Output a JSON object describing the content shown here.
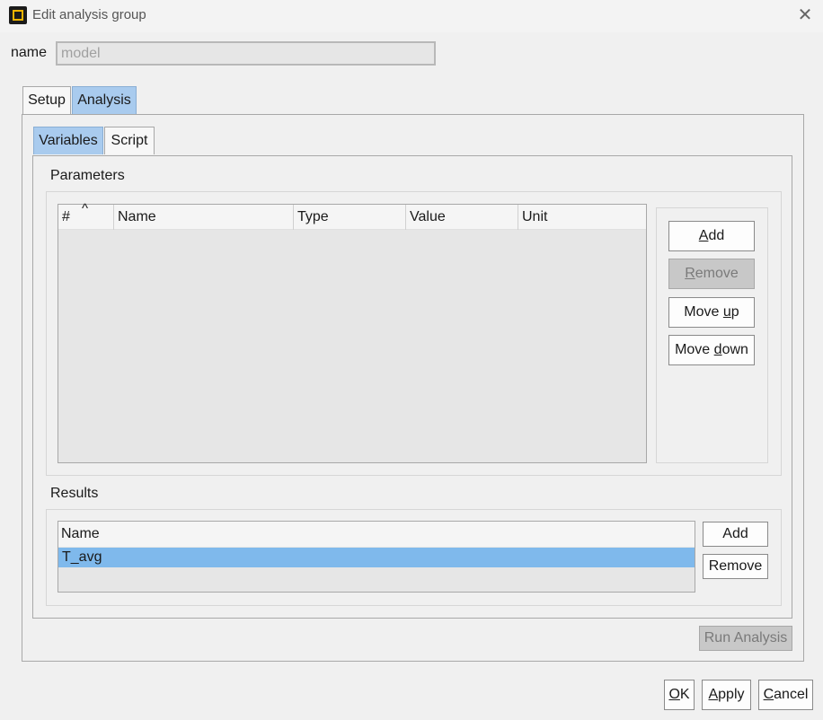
{
  "window": {
    "title": "Edit analysis group",
    "close_glyph": "✕"
  },
  "name_field": {
    "label": "name",
    "value": "model"
  },
  "outer_tabs": [
    {
      "label": "Setup",
      "active": false
    },
    {
      "label": "Analysis",
      "active": true
    }
  ],
  "inner_tabs": [
    {
      "label": "Variables",
      "active": true
    },
    {
      "label": "Script",
      "active": false
    }
  ],
  "parameters": {
    "label": "Parameters",
    "columns": [
      "#",
      "Name",
      "Type",
      "Value",
      "Unit"
    ],
    "sort_indicator": "^",
    "rows": [],
    "buttons": {
      "add": {
        "pre": "",
        "mn": "A",
        "post": "dd"
      },
      "remove": {
        "pre": "",
        "mn": "R",
        "post": "emove",
        "disabled": true
      },
      "move_up": {
        "pre": "Move ",
        "mn": "u",
        "post": "p"
      },
      "move_down": {
        "pre": "Move ",
        "mn": "d",
        "post": "own"
      }
    }
  },
  "results": {
    "label": "Results",
    "columns": [
      "Name"
    ],
    "rows": [
      "T_avg"
    ],
    "selected_row": 0,
    "buttons": {
      "add": "Add",
      "remove": "Remove"
    }
  },
  "run_analysis": {
    "label": "Run Analysis",
    "disabled": true
  },
  "footer": {
    "ok": {
      "pre": "",
      "mn": "O",
      "post": "K"
    },
    "apply": {
      "pre": "",
      "mn": "A",
      "post": "pply"
    },
    "cancel": {
      "pre": "",
      "mn": "C",
      "post": "ancel"
    }
  },
  "colors": {
    "tab_active": "#a9cbee",
    "selection": "#7fb9ec",
    "icon_accent": "#f0b400"
  }
}
